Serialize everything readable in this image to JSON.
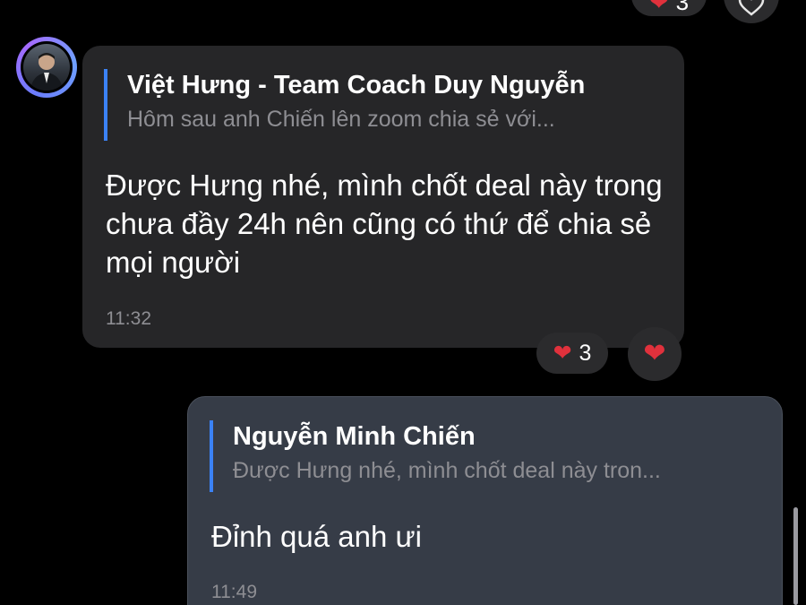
{
  "top_reactions": {
    "heart": "❤",
    "count": "3"
  },
  "incoming": {
    "avatar_alt": "sender-avatar",
    "quote_author": "Việt Hưng - Team Coach Duy Nguyễn",
    "quote_text": "Hôm sau anh Chiến lên zoom chia sẻ với...",
    "message": "Được Hưng nhé, mình chốt deal này trong chưa đầy 24h nên cũng có thứ để chia sẻ mọi người",
    "time": "11:32",
    "reactions": {
      "heart": "❤",
      "count": "3"
    },
    "react_button_heart": "❤"
  },
  "outgoing": {
    "quote_author": "Nguyễn Minh Chiến",
    "quote_text": "Được Hưng nhé, mình chốt deal này tron...",
    "message": "Đỉnh quá anh ưi",
    "time": "11:49"
  },
  "colors": {
    "background": "#000000",
    "incoming_bubble": "#262628",
    "outgoing_bubble": "#363c47",
    "quote_bar": "#3b82f6",
    "heart": "#e0313c"
  }
}
